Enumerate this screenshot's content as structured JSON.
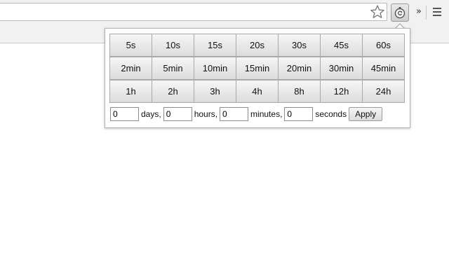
{
  "toolbar": {
    "bookmark_icon": "star-outline-icon",
    "extension_icon": "timer-refresh-icon",
    "overflow_label": "»",
    "menu_icon": "hamburger-menu-icon"
  },
  "popup": {
    "presets": [
      [
        "5s",
        "10s",
        "15s",
        "20s",
        "30s",
        "45s",
        "60s"
      ],
      [
        "2min",
        "5min",
        "10min",
        "15min",
        "20min",
        "30min",
        "45min"
      ],
      [
        "1h",
        "2h",
        "3h",
        "4h",
        "8h",
        "12h",
        "24h"
      ]
    ],
    "custom": {
      "days_value": "0",
      "days_label": "days,",
      "hours_value": "0",
      "hours_label": "hours,",
      "minutes_value": "0",
      "minutes_label": "minutes,",
      "seconds_value": "0",
      "seconds_label": "seconds",
      "apply_label": "Apply"
    }
  }
}
